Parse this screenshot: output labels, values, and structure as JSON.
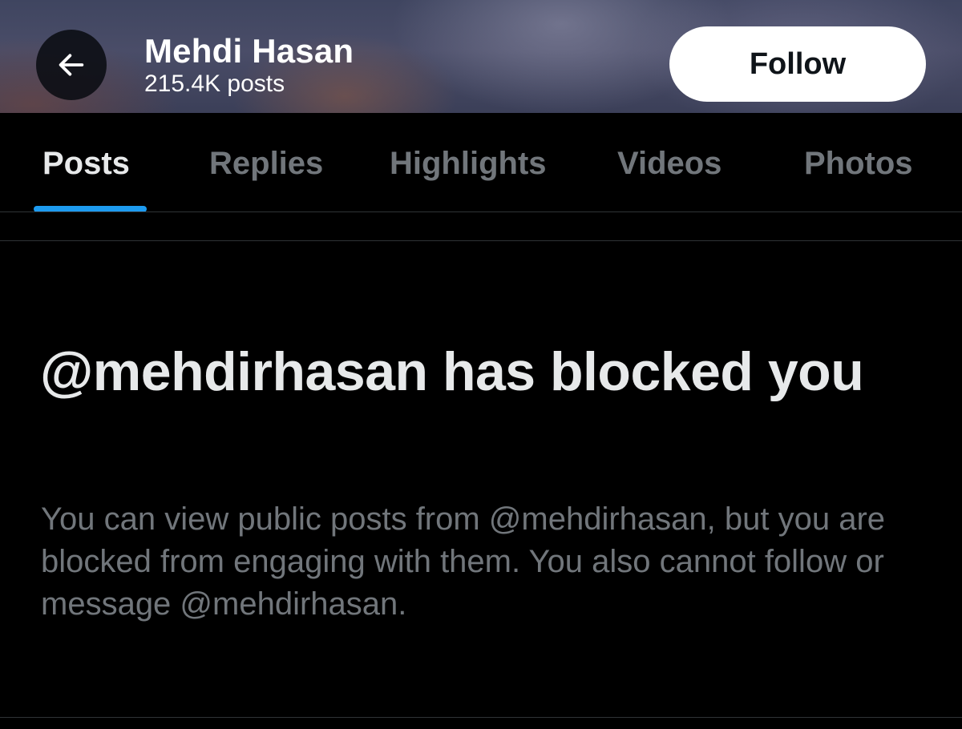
{
  "header": {
    "back_icon": "arrow-left-icon",
    "name": "Mehdi Hasan",
    "post_count": "215.4K posts",
    "follow_label": "Follow"
  },
  "tabs": [
    {
      "label": "Posts",
      "active": true
    },
    {
      "label": "Replies",
      "active": false
    },
    {
      "label": "Highlights",
      "active": false
    },
    {
      "label": "Videos",
      "active": false
    },
    {
      "label": "Photos",
      "active": false
    }
  ],
  "blocked": {
    "title": "@mehdirhasan has blocked you",
    "body": "You can view public posts from @mehdirhasan, but you are blocked from engaging with them. You also cannot follow or message @mehdirhasan."
  },
  "colors": {
    "background": "#000000",
    "accent": "#1d9bf0",
    "primary_text": "#e7e9ea",
    "secondary_text": "#71767b",
    "follow_button_bg": "#ffffff"
  }
}
